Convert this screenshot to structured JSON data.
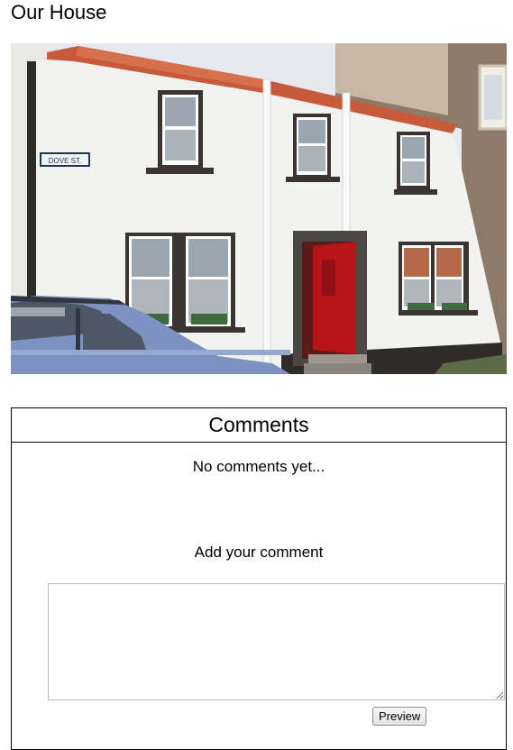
{
  "page": {
    "title": "Our House"
  },
  "photo": {
    "street_sign": "DOVE ST.",
    "colors": {
      "wall": "#f2f2f0",
      "roof": "#c85a3c",
      "door": "#b81418",
      "trim": "#3a3532",
      "car": "#7d92c2",
      "sky": "#e6eaee",
      "stone": "#8e7a68"
    }
  },
  "comments": {
    "heading": "Comments",
    "empty_text": "No comments yet...",
    "add_label": "Add your comment",
    "textarea_value": "",
    "preview_label": "Preview"
  }
}
